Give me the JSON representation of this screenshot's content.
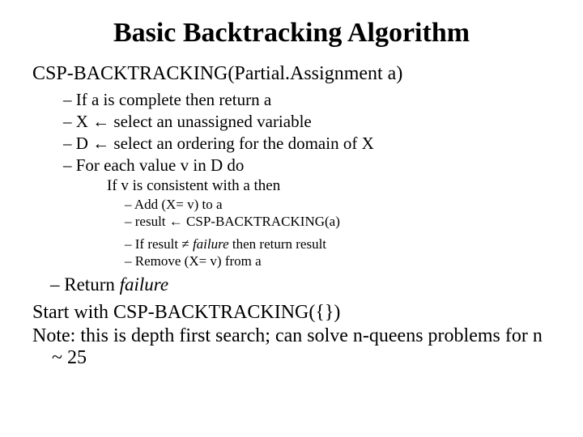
{
  "title": "Basic Backtracking Algorithm",
  "heading": "CSP-BACKTRACKING(Partial.Assignment a)",
  "step1": "If a is complete then return a",
  "step2_pre": "X ",
  "step2_post": " select an unassigned variable",
  "step3_pre": "D ",
  "step3_post": " select an ordering for the domain of X",
  "step4": "For each value v in D do",
  "inner_if": "If v is consistent with a then",
  "inner1": "Add (X= v) to a",
  "inner2_pre": "result ",
  "inner2_post": " CSP-BACKTRACKING(a)",
  "inner3_pre": "If result ",
  "inner3_mid": "failure",
  "inner3_post": " then return result",
  "inner4": "Remove (X= v) from a",
  "return_pre": "Return ",
  "return_word": "failure",
  "start": "Start with CSP-BACKTRACKING({})",
  "note": "Note: this is depth first search; can solve n-queens problems for n ~ 25",
  "arrow": "←",
  "neq": "≠"
}
